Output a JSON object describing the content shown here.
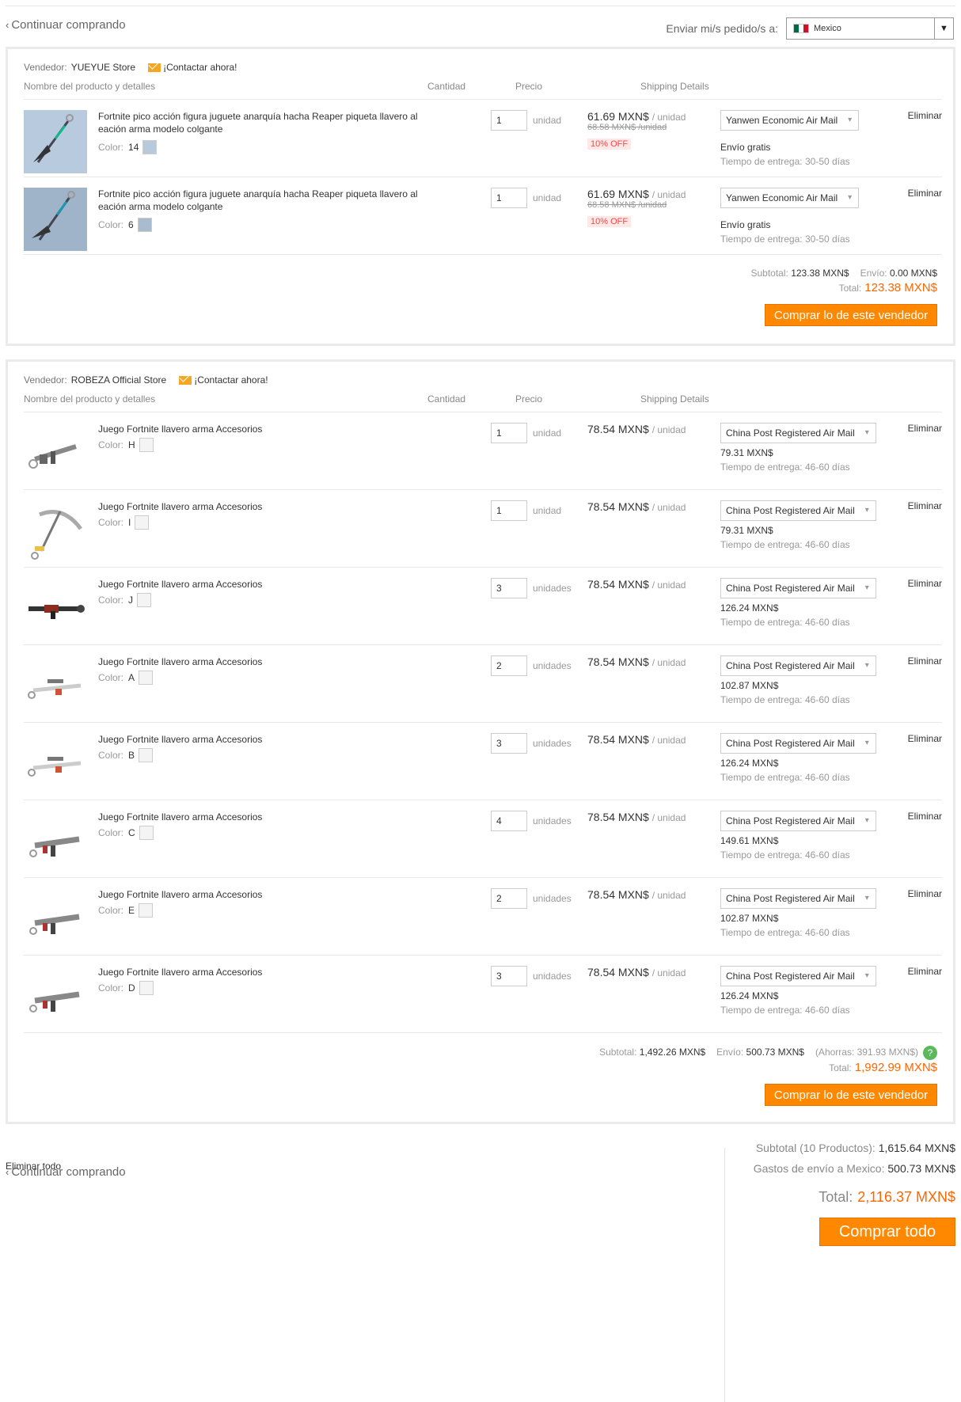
{
  "nav": {
    "continue_top": "Continuar comprando",
    "continue_bottom": "Continuar comprando",
    "ship_to_label": "Enviar mi/s pedido/s a:",
    "country": "Mexico"
  },
  "headers": {
    "product": "Nombre del producto y detalles",
    "quantity": "Cantidad",
    "price": "Precio",
    "shipping": "Shipping Details"
  },
  "stores": [
    {
      "vendor_label": "Vendedor:",
      "vendor_name": "YUEYUE Store",
      "contact": "¡Contactar ahora!",
      "items": [
        {
          "name": "Fortnite pico acción figura juguete anarquía hacha Reaper piqueta llavero al eación arma modelo colgante",
          "color_label": "Color:",
          "color": "14",
          "qty": "1",
          "unit": "unidad",
          "price": "61.69 MXN$",
          "per": "/ unidad",
          "old_price": "68.58 MXN$ /unidad",
          "discount": "10% OFF",
          "shipping_method": "Yanwen Economic Air Mail",
          "shipping_cost": "Envío gratis",
          "delivery_label": "Tiempo de entrega:",
          "delivery": "30-50 días",
          "remove": "Eliminar",
          "thumb_icon": "pickaxe-keychain-icon"
        },
        {
          "name": "Fortnite pico acción figura juguete anarquía hacha Reaper piqueta llavero al eación arma modelo colgante",
          "color_label": "Color:",
          "color": "6",
          "qty": "1",
          "unit": "unidad",
          "price": "61.69 MXN$",
          "per": "/ unidad",
          "old_price": "68.58 MXN$ /unidad",
          "discount": "10% OFF",
          "shipping_method": "Yanwen Economic Air Mail",
          "shipping_cost": "Envío gratis",
          "delivery_label": "Tiempo de entrega:",
          "delivery": "30-50 días",
          "remove": "Eliminar",
          "thumb_icon": "pickaxe-keychain-icon"
        }
      ],
      "subtotal_label": "Subtotal:",
      "subtotal": "123.38 MXN$",
      "shipping_label": "Envío:",
      "shipping": "0.00 MXN$",
      "total_label": "Total:",
      "total": "123.38 MXN$",
      "buy_label": "Comprar lo de este vendedor"
    },
    {
      "vendor_label": "Vendedor:",
      "vendor_name": "ROBEZA Official Store",
      "contact": "¡Contactar ahora!",
      "items": [
        {
          "name": "Juego Fortnite llavero arma Accesorios",
          "color_label": "Color:",
          "color": "H",
          "qty": "1",
          "unit": "unidad",
          "price": "78.54 MXN$",
          "per": "/ unidad",
          "shipping_method": "China Post Registered Air Mail",
          "shipping_cost": "79.31 MXN$",
          "delivery_label": "Tiempo de entrega:",
          "delivery": "46-60 días",
          "remove": "Eliminar",
          "thumb_icon": "gun-keychain-icon"
        },
        {
          "name": "Juego Fortnite llavero arma Accesorios",
          "color_label": "Color:",
          "color": "I",
          "qty": "1",
          "unit": "unidad",
          "price": "78.54 MXN$",
          "per": "/ unidad",
          "shipping_method": "China Post Registered Air Mail",
          "shipping_cost": "79.31 MXN$",
          "delivery_label": "Tiempo de entrega:",
          "delivery": "46-60 días",
          "remove": "Eliminar",
          "thumb_icon": "pickaxe-keychain-icon"
        },
        {
          "name": "Juego Fortnite llavero arma Accesorios",
          "color_label": "Color:",
          "color": "J",
          "qty": "3",
          "unit": "unidades",
          "price": "78.54 MXN$",
          "per": "/ unidad",
          "shipping_method": "China Post Registered Air Mail",
          "shipping_cost": "126.24 MXN$",
          "delivery_label": "Tiempo de entrega:",
          "delivery": "46-60 días",
          "remove": "Eliminar",
          "thumb_icon": "rocket-launcher-keychain-icon"
        },
        {
          "name": "Juego Fortnite llavero arma Accesorios",
          "color_label": "Color:",
          "color": "A",
          "qty": "2",
          "unit": "unidades",
          "price": "78.54 MXN$",
          "per": "/ unidad",
          "shipping_method": "China Post Registered Air Mail",
          "shipping_cost": "102.87 MXN$",
          "delivery_label": "Tiempo de entrega:",
          "delivery": "46-60 días",
          "remove": "Eliminar",
          "thumb_icon": "sniper-keychain-icon"
        },
        {
          "name": "Juego Fortnite llavero arma Accesorios",
          "color_label": "Color:",
          "color": "B",
          "qty": "3",
          "unit": "unidades",
          "price": "78.54 MXN$",
          "per": "/ unidad",
          "shipping_method": "China Post Registered Air Mail",
          "shipping_cost": "126.24 MXN$",
          "delivery_label": "Tiempo de entrega:",
          "delivery": "46-60 días",
          "remove": "Eliminar",
          "thumb_icon": "sniper-keychain-icon"
        },
        {
          "name": "Juego Fortnite llavero arma Accesorios",
          "color_label": "Color:",
          "color": "C",
          "qty": "4",
          "unit": "unidades",
          "price": "78.54 MXN$",
          "per": "/ unidad",
          "shipping_method": "China Post Registered Air Mail",
          "shipping_cost": "149.61 MXN$",
          "delivery_label": "Tiempo de entrega:",
          "delivery": "46-60 días",
          "remove": "Eliminar",
          "thumb_icon": "rifle-keychain-icon"
        },
        {
          "name": "Juego Fortnite llavero arma Accesorios",
          "color_label": "Color:",
          "color": "E",
          "qty": "2",
          "unit": "unidades",
          "price": "78.54 MXN$",
          "per": "/ unidad",
          "shipping_method": "China Post Registered Air Mail",
          "shipping_cost": "102.87 MXN$",
          "delivery_label": "Tiempo de entrega:",
          "delivery": "46-60 días",
          "remove": "Eliminar",
          "thumb_icon": "rifle-keychain-icon"
        },
        {
          "name": "Juego Fortnite llavero arma Accesorios",
          "color_label": "Color:",
          "color": "D",
          "qty": "3",
          "unit": "unidades",
          "price": "78.54 MXN$",
          "per": "/ unidad",
          "shipping_method": "China Post Registered Air Mail",
          "shipping_cost": "126.24 MXN$",
          "delivery_label": "Tiempo de entrega:",
          "delivery": "46-60 días",
          "remove": "Eliminar",
          "thumb_icon": "rifle-keychain-icon"
        }
      ],
      "subtotal_label": "Subtotal:",
      "subtotal": "1,492.26 MXN$",
      "shipping_label": "Envío:",
      "shipping": "500.73 MXN$",
      "savings": "(Ahorras: 391.93 MXN$)",
      "total_label": "Total:",
      "total": "1,992.99 MXN$",
      "buy_label": "Comprar lo de este vendedor"
    }
  ],
  "footer": {
    "remove_all": "Eliminar todo",
    "subtotal_label": "Subtotal (10 Productos):",
    "subtotal": "1,615.64 MXN$",
    "shipping_label": "Gastos de envío a Mexico:",
    "shipping": "500.73 MXN$",
    "total_label": "Total:",
    "total": "2,116.37 MXN$",
    "buy_all": "Comprar todo"
  },
  "colors": {
    "accent": "#ff8800",
    "price_red": "#ff6600",
    "discount_bg": "#ffe8e6",
    "help_green": "#5cb85c"
  }
}
